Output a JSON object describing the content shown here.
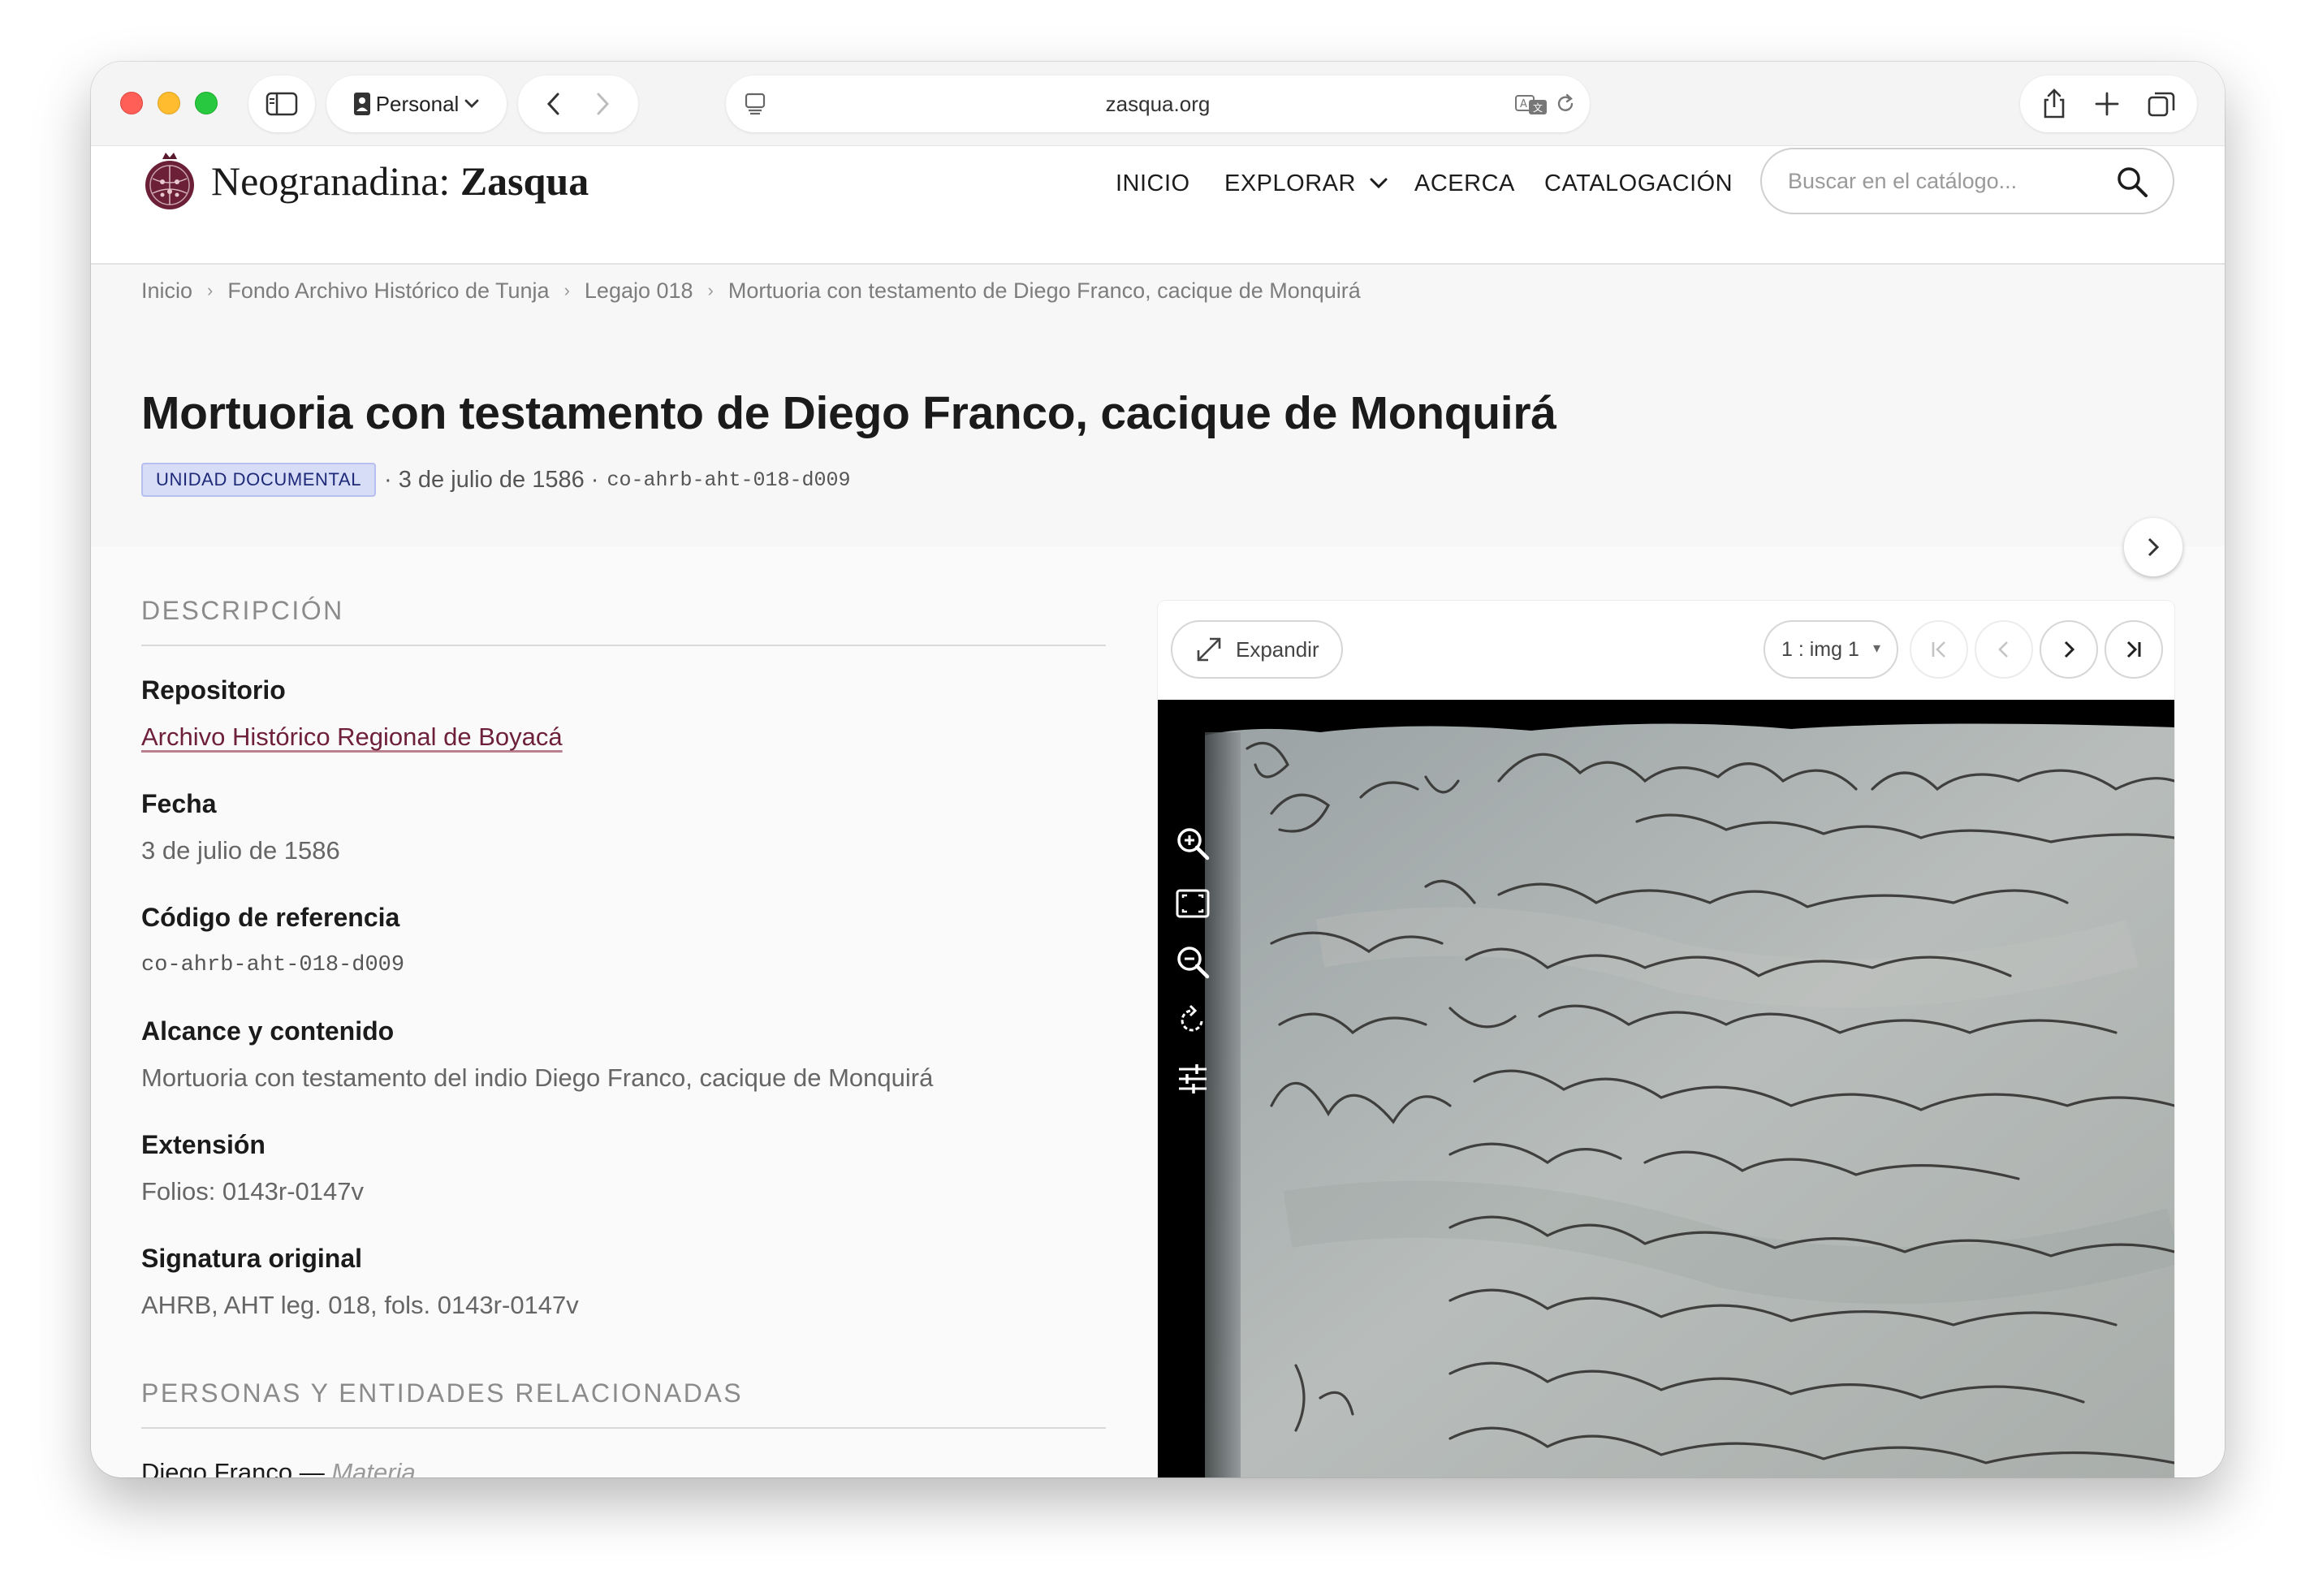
{
  "browser": {
    "profile_label": "Personal",
    "url": "zasqua.org",
    "icons": [
      "sidebar-icon",
      "person-icon",
      "chevron-down-icon",
      "back-icon",
      "forward-icon",
      "page-menu-icon",
      "translate-icon",
      "reload-icon",
      "share-icon",
      "plus-icon",
      "tabs-overview-icon"
    ]
  },
  "site": {
    "brand_regular": "Neogranadina: ",
    "brand_bold": "Zasqua",
    "nav": {
      "inicio": "INICIO",
      "explorar": "EXPLORAR",
      "acerca": "ACERCA",
      "catalogacion": "CATALOGACIÓN"
    },
    "search_placeholder": "Buscar en el catálogo..."
  },
  "breadcrumb": [
    "Inicio",
    "Fondo Archivo Histórico de Tunja",
    "Legajo 018",
    "Mortuoria con testamento de Diego Franco, cacique de Monquirá"
  ],
  "record": {
    "title": "Mortuoria con testamento de Diego Franco, cacique de Monquirá",
    "level_badge": "UNIDAD DOCUMENTAL",
    "date_meta": "· 3 de julio de 1586 ·",
    "code_meta": "co-ahrb-aht-018-d009",
    "badge_color": "#d7dcf7"
  },
  "description": {
    "heading": "DESCRIPCIÓN",
    "fields": [
      {
        "label": "Repositorio",
        "value": "Archivo Histórico Regional de Boyacá"
      },
      {
        "label": "Fecha",
        "value": "3 de julio de 1586"
      },
      {
        "label": "Código de referencia",
        "value": "co-ahrb-aht-018-d009"
      },
      {
        "label": "Alcance y contenido",
        "value": "Mortuoria con testamento del indio Diego Franco, cacique de Monquirá"
      },
      {
        "label": "Extensión",
        "value": "Folios: 0143r-0147v"
      },
      {
        "label": "Signatura original",
        "value": "AHRB, AHT leg. 018, fols. 0143r-0147v"
      }
    ],
    "related_heading": "PERSONAS Y ENTIDADES RELACIONADAS",
    "related": [
      {
        "name": "Diego Franco",
        "sep": " — ",
        "role": "Materia"
      }
    ]
  },
  "viewer": {
    "expand_label": "Expandir",
    "image_select_value": "1 : img 1",
    "image_select_caret": "▾",
    "tools": [
      "zoom-in-icon",
      "fit-screen-icon",
      "zoom-out-icon",
      "rotate-icon",
      "adjust-icon"
    ]
  },
  "colors": {
    "link": "#6d1f3b",
    "accent_badge_text": "#1e2a78"
  }
}
